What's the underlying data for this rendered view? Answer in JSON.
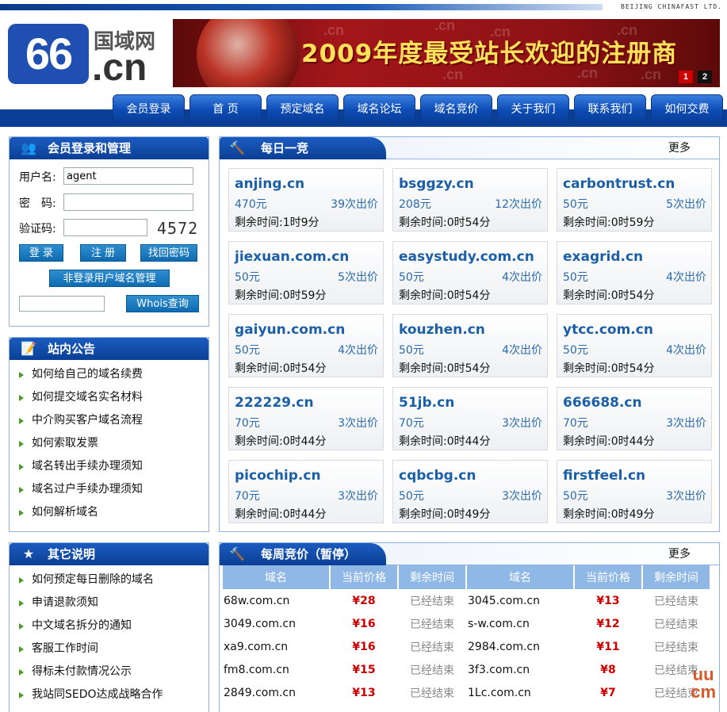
{
  "header": {
    "company": "BEIJING CHINAFAST LTD.",
    "logo_num": "66",
    "logo_name": "国域网",
    "logo_tld": ".cn",
    "banner_slogan": "2009年度最受站长欢迎的注册商",
    "banner_pages": [
      "1",
      "2"
    ]
  },
  "nav": [
    "会员登录",
    "首 页",
    "预定域名",
    "域名论坛",
    "域名竞价",
    "关于我们",
    "联系我们",
    "如何交费"
  ],
  "login": {
    "title": "会员登录和管理",
    "username_label": "用户名:",
    "username_value": "agent",
    "password_label": "密　码:",
    "captcha_label": "验证码:",
    "captcha_text": "4572",
    "login_btn": "登 录",
    "register_btn": "注 册",
    "recover_btn": "找回密码",
    "nonlogin_btn": "非登录用户域名管理",
    "whois_btn": "Whois查询"
  },
  "notice": {
    "title": "站内公告",
    "items": [
      "如何给自己的域名续费",
      "如何提交域名实名材料",
      "中介购买客户域名流程",
      "如何索取发票",
      "域名转出手续办理须知",
      "域名过户手续办理须知",
      "如何解析域名"
    ]
  },
  "other": {
    "title": "其它说明",
    "items": [
      "如何预定每日删除的域名",
      "申请退款须知",
      "中文域名拆分的通知",
      "客服工作时间",
      "得标未付款情况公示",
      "我站同SEDO达成战略合作"
    ]
  },
  "daily": {
    "title": "每日一竞",
    "more": "更多",
    "cards": [
      {
        "domain": "anjing.cn",
        "price": "470元",
        "bids": "39次出价",
        "remaining": "剩余时间:1时9分"
      },
      {
        "domain": "bsggzy.cn",
        "price": "208元",
        "bids": "12次出价",
        "remaining": "剩余时间:0时54分"
      },
      {
        "domain": "carbontrust.cn",
        "price": "50元",
        "bids": "5次出价",
        "remaining": "剩余时间:0时59分"
      },
      {
        "domain": "jiexuan.com.cn",
        "price": "50元",
        "bids": "5次出价",
        "remaining": "剩余时间:0时59分"
      },
      {
        "domain": "easystudy.com.cn",
        "price": "50元",
        "bids": "4次出价",
        "remaining": "剩余时间:0时54分"
      },
      {
        "domain": "exagrid.cn",
        "price": "50元",
        "bids": "4次出价",
        "remaining": "剩余时间:0时54分"
      },
      {
        "domain": "gaiyun.com.cn",
        "price": "50元",
        "bids": "4次出价",
        "remaining": "剩余时间:0时54分"
      },
      {
        "domain": "kouzhen.cn",
        "price": "50元",
        "bids": "4次出价",
        "remaining": "剩余时间:0时54分"
      },
      {
        "domain": "ytcc.com.cn",
        "price": "50元",
        "bids": "4次出价",
        "remaining": "剩余时间:0时54分"
      },
      {
        "domain": "222229.cn",
        "price": "70元",
        "bids": "3次出价",
        "remaining": "剩余时间:0时44分"
      },
      {
        "domain": "51jb.cn",
        "price": "70元",
        "bids": "3次出价",
        "remaining": "剩余时间:0时44分"
      },
      {
        "domain": "666688.cn",
        "price": "70元",
        "bids": "3次出价",
        "remaining": "剩余时间:0时44分"
      },
      {
        "domain": "picochip.cn",
        "price": "70元",
        "bids": "3次出价",
        "remaining": "剩余时间:0时44分"
      },
      {
        "domain": "cqbcbg.cn",
        "price": "50元",
        "bids": "3次出价",
        "remaining": "剩余时间:0时49分"
      },
      {
        "domain": "firstfeel.cn",
        "price": "50元",
        "bids": "3次出价",
        "remaining": "剩余时间:0时49分"
      }
    ]
  },
  "weekly": {
    "title": "每周竞价（暂停）",
    "more": "更多",
    "headers": [
      "域名",
      "当前价格",
      "剩余时间",
      "域名",
      "当前价格",
      "剩余时间"
    ],
    "rows": [
      [
        "68w.com.cn",
        "¥28",
        "已经结束",
        "3045.com.cn",
        "¥13",
        "已经结束"
      ],
      [
        "3049.com.cn",
        "¥16",
        "已经结束",
        "s-w.com.cn",
        "¥12",
        "已经结束"
      ],
      [
        "xa9.com.cn",
        "¥16",
        "已经结束",
        "2984.com.cn",
        "¥11",
        "已经结束"
      ],
      [
        "fm8.com.cn",
        "¥15",
        "已经结束",
        "3f3.com.cn",
        "¥8",
        "已经结束"
      ],
      [
        "2849.com.cn",
        "¥13",
        "已经结束",
        "1Lc.com.cn",
        "¥7",
        "已经结束"
      ]
    ]
  },
  "watermark": {
    "line1": "uu",
    "line2": "cm"
  }
}
